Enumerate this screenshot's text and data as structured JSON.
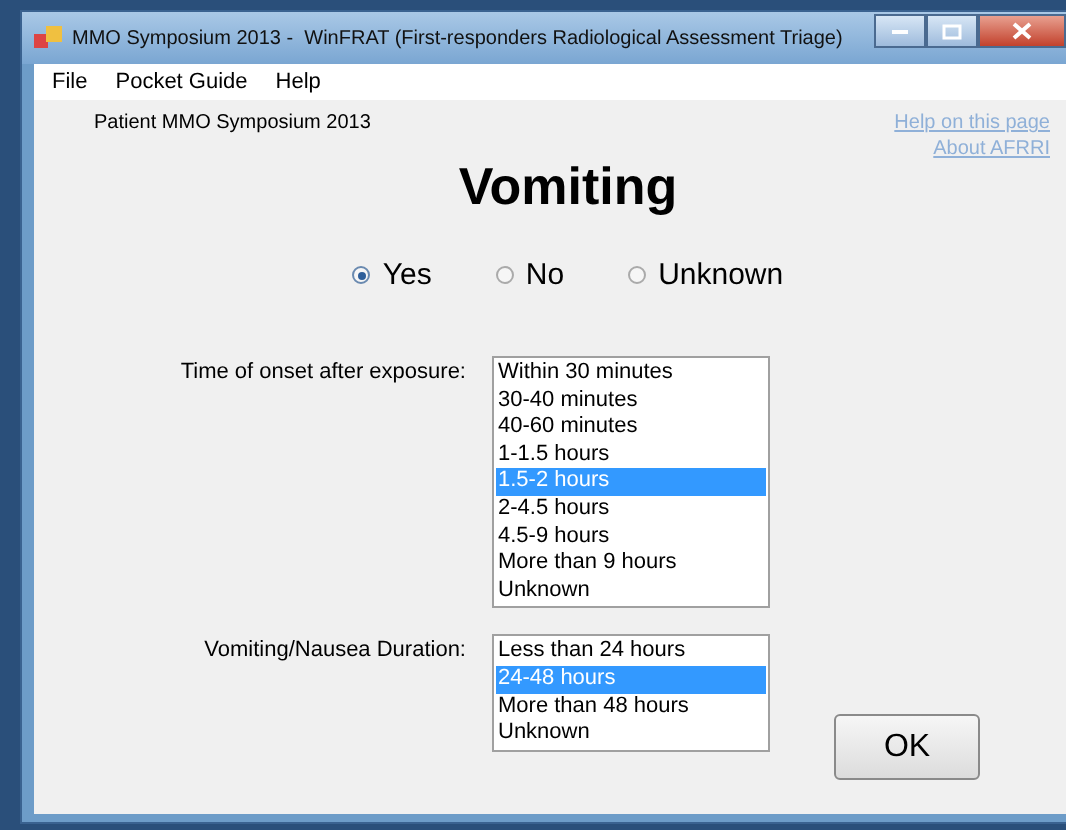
{
  "window": {
    "title": "MMO Symposium 2013 -  WinFRAT (First-responders Radiological Assessment Triage)"
  },
  "menu": [
    "File",
    "Pocket Guide",
    "Help"
  ],
  "patient": "Patient  MMO Symposium 2013",
  "links": [
    "Help on this page",
    "About AFRRI"
  ],
  "heading": "Vomiting",
  "radios": [
    {
      "label": "Yes",
      "selected": true
    },
    {
      "label": "No",
      "selected": false
    },
    {
      "label": "Unknown",
      "selected": false
    }
  ],
  "fields": [
    {
      "label": "Time of onset after exposure:",
      "options": [
        {
          "text": "Within 30 minutes",
          "selected": false
        },
        {
          "text": "30-40 minutes",
          "selected": false
        },
        {
          "text": "40-60 minutes",
          "selected": false
        },
        {
          "text": "1-1.5 hours",
          "selected": false
        },
        {
          "text": "1.5-2 hours",
          "selected": true
        },
        {
          "text": "2-4.5 hours",
          "selected": false
        },
        {
          "text": "4.5-9 hours",
          "selected": false
        },
        {
          "text": "More than 9 hours",
          "selected": false
        },
        {
          "text": "Unknown",
          "selected": false
        }
      ]
    },
    {
      "label": "Vomiting/Nausea Duration:",
      "options": [
        {
          "text": "Less than 24 hours",
          "selected": false
        },
        {
          "text": "24-48 hours",
          "selected": true
        },
        {
          "text": "More than 48 hours",
          "selected": false
        },
        {
          "text": "Unknown",
          "selected": false
        }
      ]
    }
  ],
  "ok_button": "OK"
}
